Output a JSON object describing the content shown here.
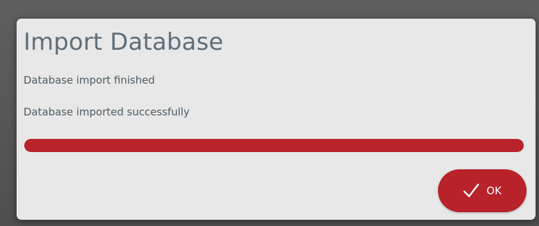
{
  "dialog": {
    "title": "Import Database",
    "status_message": "Database import finished",
    "detail_message": "Database imported successfully",
    "progress": 1.0,
    "ok_button": {
      "label": "OK",
      "icon": "check-icon"
    }
  },
  "colors": {
    "accent": "#b8222b",
    "dialog_background": "#e8e8e8",
    "title_text": "#5f6e78",
    "body_text": "#4d5a63",
    "backdrop": "#575757"
  }
}
